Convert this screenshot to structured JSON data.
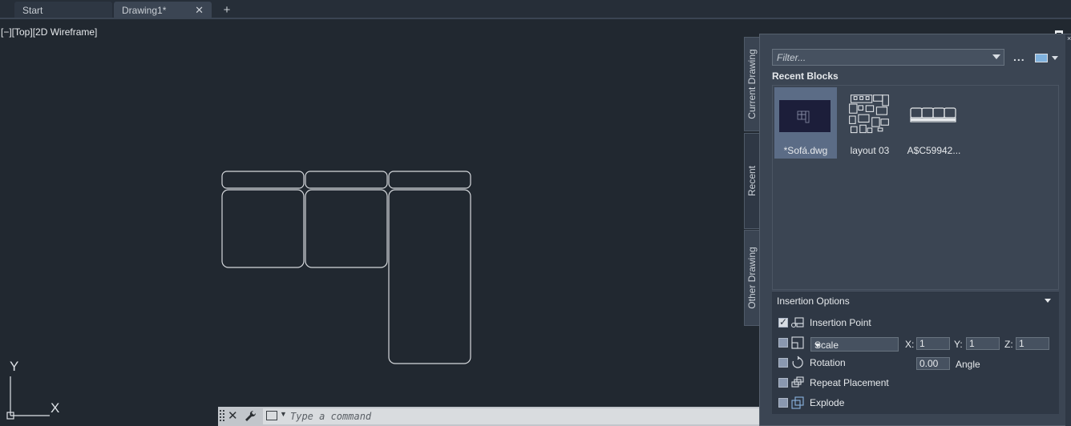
{
  "tabs": [
    {
      "label": "Start"
    },
    {
      "label": "Drawing1*",
      "close": "✕"
    }
  ],
  "tab_add": "+",
  "viewport": {
    "label": "[−][Top][2D Wireframe]"
  },
  "ucs": {
    "y_label": "Y",
    "x_label": "X"
  },
  "command_line": {
    "close": "✕",
    "placeholder": "Type a command"
  },
  "palette": {
    "vertical_tabs": [
      {
        "label": "Current Drawing"
      },
      {
        "label": "Recent",
        "active": true
      },
      {
        "label": "Other Drawing"
      }
    ],
    "grip_close": "×",
    "filter_placeholder": "Filter...",
    "ellipsis": "...",
    "section_title": "Recent Blocks",
    "blocks": [
      {
        "label": "*Sofá.dwg",
        "selected": true
      },
      {
        "label": "layout 03"
      },
      {
        "label": "A$C59942..."
      }
    ],
    "insertion_options": {
      "title": "Insertion Options",
      "insertion_point": {
        "label": "Insertion Point",
        "checked": true
      },
      "scale": {
        "selected": "Scale",
        "x_label": "X:",
        "x": "1",
        "y_label": "Y:",
        "y": "1",
        "z_label": "Z:",
        "z": "1",
        "checked": false
      },
      "rotation": {
        "label": "Rotation",
        "value": "0.00",
        "angle_label": "Angle",
        "checked": false
      },
      "repeat_placement": {
        "label": "Repeat Placement",
        "checked": false
      },
      "explode": {
        "label": "Explode",
        "checked": false
      }
    }
  },
  "colors": {
    "background": "#212830",
    "geometry_stroke": "#d6d9dd",
    "palette_bg": "#3b4553",
    "selected_block": "#5b6c86"
  }
}
